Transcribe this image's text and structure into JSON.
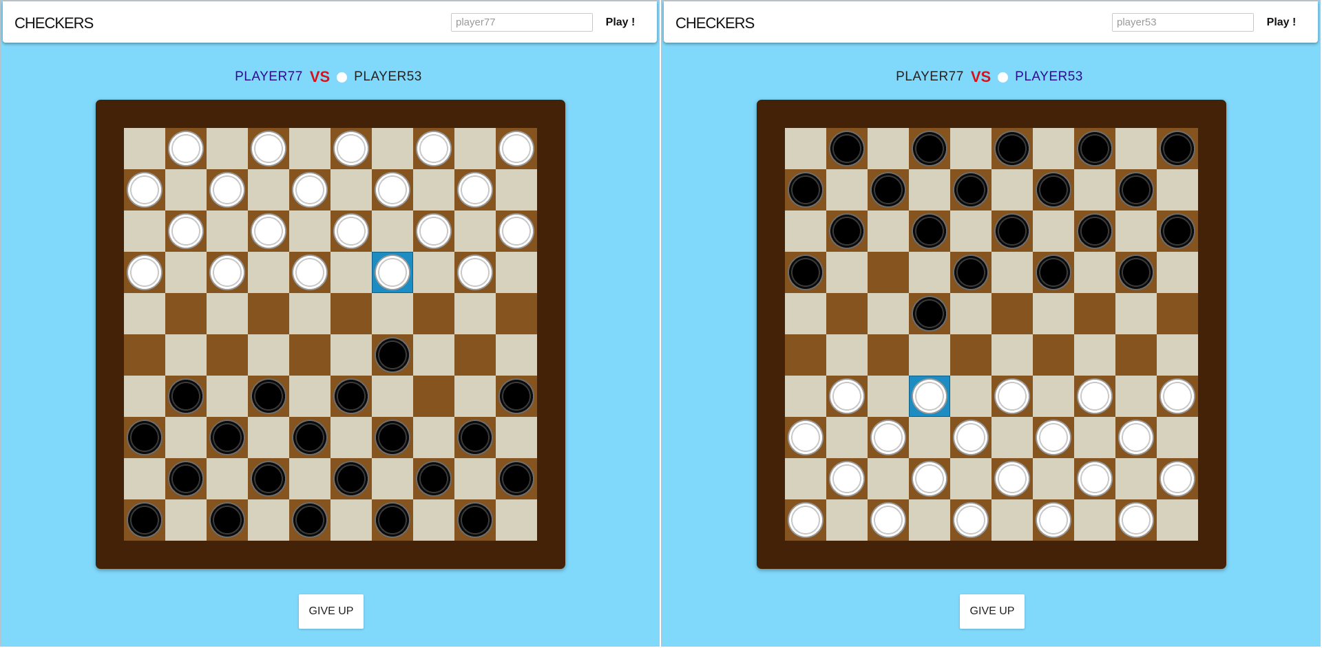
{
  "windows": [
    {
      "logo": "CHECKERS",
      "name_input": {
        "value": "",
        "placeholder": "player77"
      },
      "play_label": "Play !",
      "header": {
        "left_player": "PLAYER77",
        "vs": "VS",
        "right_player": "PLAYER53",
        "active_side": "left"
      },
      "board": {
        "selected": [
          3,
          6
        ],
        "pieces": [
          ".w.w.w.w.w",
          "w.w.w.w.w.",
          ".w.w.w.w.w",
          "w.w.w.w.w.",
          "..........",
          "......b...",
          ".b.b.b...b",
          "b.b.b.b.b.",
          ".b.b.b.b.b",
          "b.b.b.b.b."
        ]
      },
      "give_up_label": "GIVE UP"
    },
    {
      "logo": "CHECKERS",
      "name_input": {
        "value": "",
        "placeholder": "player53"
      },
      "play_label": "Play !",
      "header": {
        "left_player": "PLAYER77",
        "vs": "VS",
        "right_player": "PLAYER53",
        "active_side": "right"
      },
      "board": {
        "selected": [
          6,
          3
        ],
        "pieces": [
          ".b.b.b.b.b",
          "b.b.b.b.b.",
          ".b.b.b.b.b",
          "b...b.b.b.",
          "...b......",
          "..........",
          ".w.w.w.w.w",
          "w.w.w.w.w.",
          ".w.w.w.w.w",
          "w.w.w.w.w."
        ]
      },
      "give_up_label": "GIVE UP"
    }
  ],
  "colors": {
    "background": "#80d8fb",
    "frame": "#432208",
    "light_square": "#d6d2bd",
    "dark_square": "#86541f",
    "selected_square": "#1c8cc3",
    "active_player": "#2a0d8f",
    "vs": "#d4141a"
  }
}
